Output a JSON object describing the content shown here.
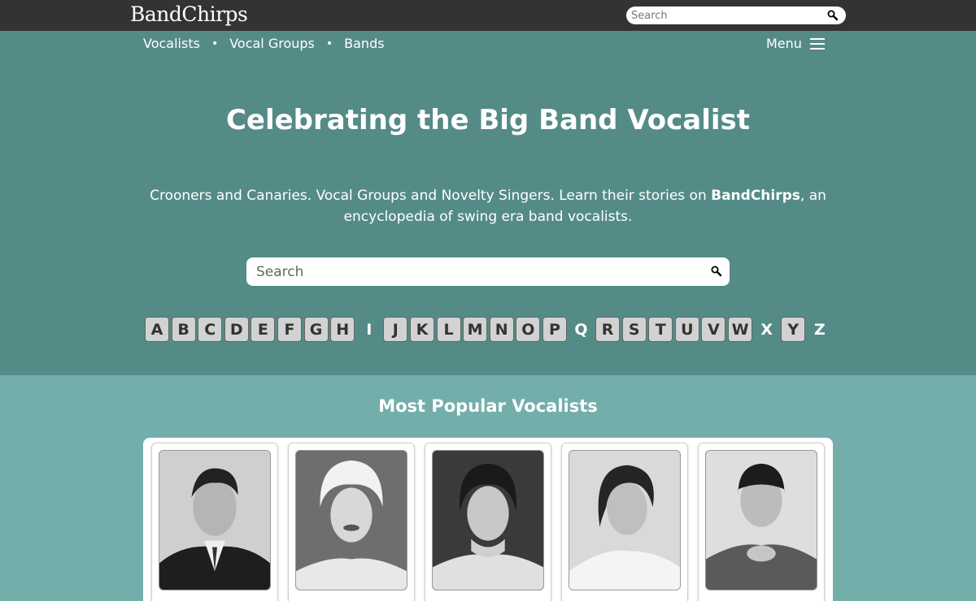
{
  "header": {
    "logo": "BandChirps",
    "search_placeholder": "Search",
    "search_icon": "magnifier-icon"
  },
  "nav": {
    "links": [
      "Vocalists",
      "Vocal Groups",
      "Bands"
    ],
    "separator": "•",
    "menu_label": "Menu",
    "menu_icon": "hamburger-icon"
  },
  "hero": {
    "title": "Celebrating the Big Band Vocalist",
    "description_before": "Crooners and Canaries. Vocal Groups and Novelty Singers. Learn their stories on ",
    "description_bold": "BandChirps",
    "description_after": ", an encyclopedia of swing era band vocalists.",
    "search_placeholder": "Search"
  },
  "alphabet": [
    {
      "letter": "A",
      "enabled": true
    },
    {
      "letter": "B",
      "enabled": true
    },
    {
      "letter": "C",
      "enabled": true
    },
    {
      "letter": "D",
      "enabled": true
    },
    {
      "letter": "E",
      "enabled": true
    },
    {
      "letter": "F",
      "enabled": true
    },
    {
      "letter": "G",
      "enabled": true
    },
    {
      "letter": "H",
      "enabled": true
    },
    {
      "letter": "I",
      "enabled": false
    },
    {
      "letter": "J",
      "enabled": true
    },
    {
      "letter": "K",
      "enabled": true
    },
    {
      "letter": "L",
      "enabled": true
    },
    {
      "letter": "M",
      "enabled": true
    },
    {
      "letter": "N",
      "enabled": true
    },
    {
      "letter": "O",
      "enabled": true
    },
    {
      "letter": "P",
      "enabled": true
    },
    {
      "letter": "Q",
      "enabled": false
    },
    {
      "letter": "R",
      "enabled": true
    },
    {
      "letter": "S",
      "enabled": true
    },
    {
      "letter": "T",
      "enabled": true
    },
    {
      "letter": "U",
      "enabled": true
    },
    {
      "letter": "V",
      "enabled": true
    },
    {
      "letter": "W",
      "enabled": true
    },
    {
      "letter": "X",
      "enabled": false
    },
    {
      "letter": "Y",
      "enabled": true
    },
    {
      "letter": "Z",
      "enabled": false
    }
  ],
  "popular": {
    "title": "Most Popular Vocalists",
    "cards": [
      {
        "photo": "vocalist-photo-man-suit"
      },
      {
        "photo": "vocalist-photo-blonde-woman"
      },
      {
        "photo": "vocalist-photo-dark-haired-woman"
      },
      {
        "photo": "vocalist-photo-woman-looking-up"
      },
      {
        "photo": "vocalist-photo-man-bowl-haircut"
      }
    ]
  },
  "colors": {
    "topbar": "#333333",
    "hero": "#548b87",
    "section": "#73aeab",
    "letter_key": "#d2d2d2"
  }
}
